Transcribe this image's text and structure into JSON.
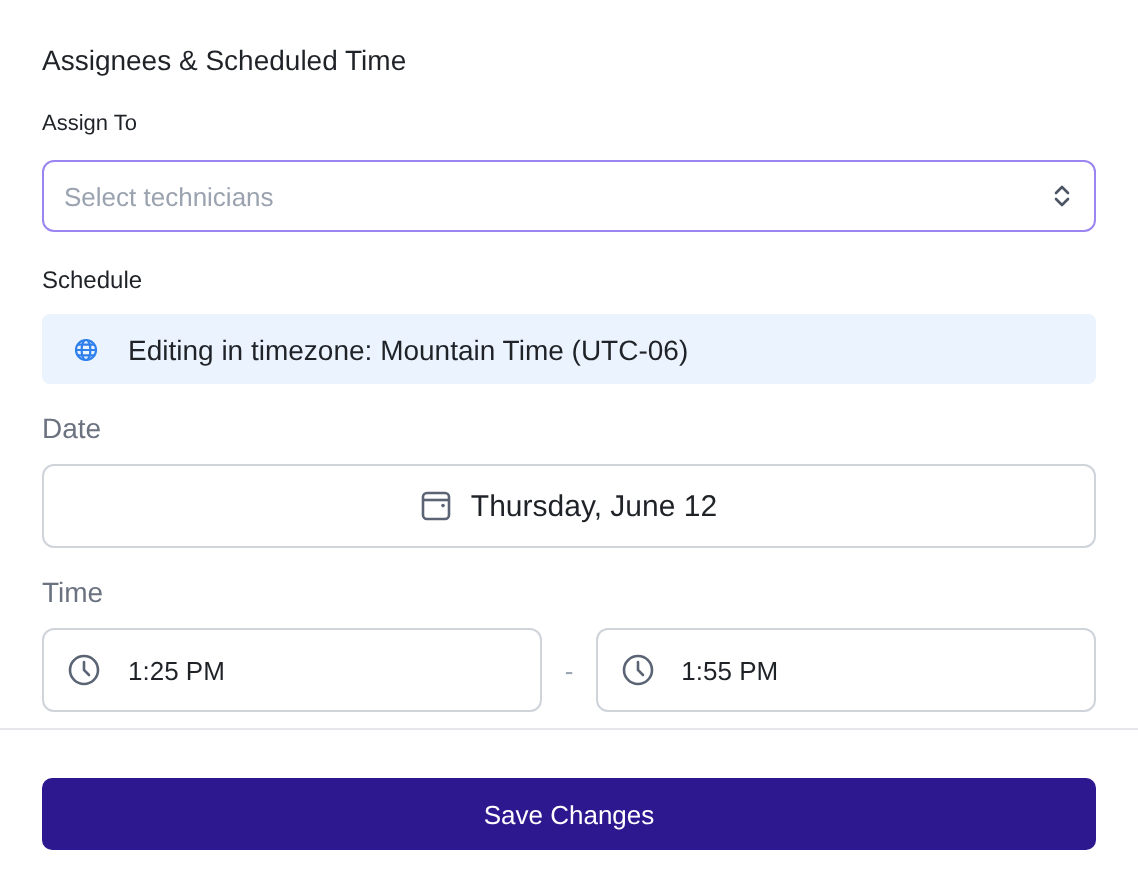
{
  "section_title": "Assignees & Scheduled Time",
  "assign": {
    "label": "Assign To",
    "placeholder": "Select technicians"
  },
  "schedule": {
    "label": "Schedule",
    "timezone_note": "Editing in timezone: Mountain Time (UTC-06)"
  },
  "date": {
    "label": "Date",
    "value": "Thursday, June 12"
  },
  "time": {
    "label": "Time",
    "start": "1:25 PM",
    "separator": "-",
    "end": "1:55 PM"
  },
  "save_button": "Save Changes"
}
